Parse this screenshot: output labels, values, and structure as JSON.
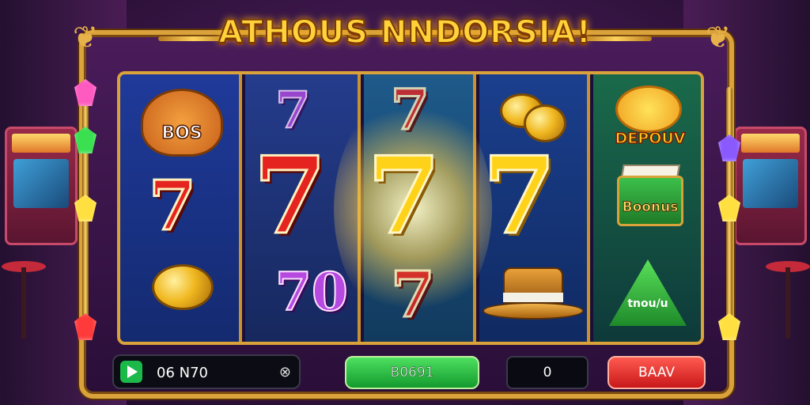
{
  "title": "ATHOUS NNDORSIA!",
  "reels": {
    "reel1": {
      "badge": "BOS",
      "symbols": [
        "7",
        "coin"
      ]
    },
    "reel2": {
      "symbols": [
        "7",
        "7",
        "70"
      ]
    },
    "reel3": {
      "symbols": [
        "7",
        "7",
        "7"
      ]
    },
    "reel4": {
      "symbols": [
        "coin",
        "7",
        "hat"
      ]
    },
    "reel5": {
      "deposit_label": "DEPOUV",
      "bonus_label": "Boonus",
      "pyramid_label": "tnou/u"
    }
  },
  "controls": {
    "balance_text": "06 N70",
    "green_button_label": "B0691",
    "bet_value": "0",
    "red_button_label": "BAAV",
    "info_glyph": "⊗"
  },
  "colors": {
    "gold": "#d9a23a",
    "green_button": "#1bb84a",
    "red_button": "#e02a2a"
  },
  "icons": [
    "play-icon",
    "info-icon",
    "gem-icon",
    "coin-icon",
    "hat-icon",
    "gift-box-icon"
  ]
}
